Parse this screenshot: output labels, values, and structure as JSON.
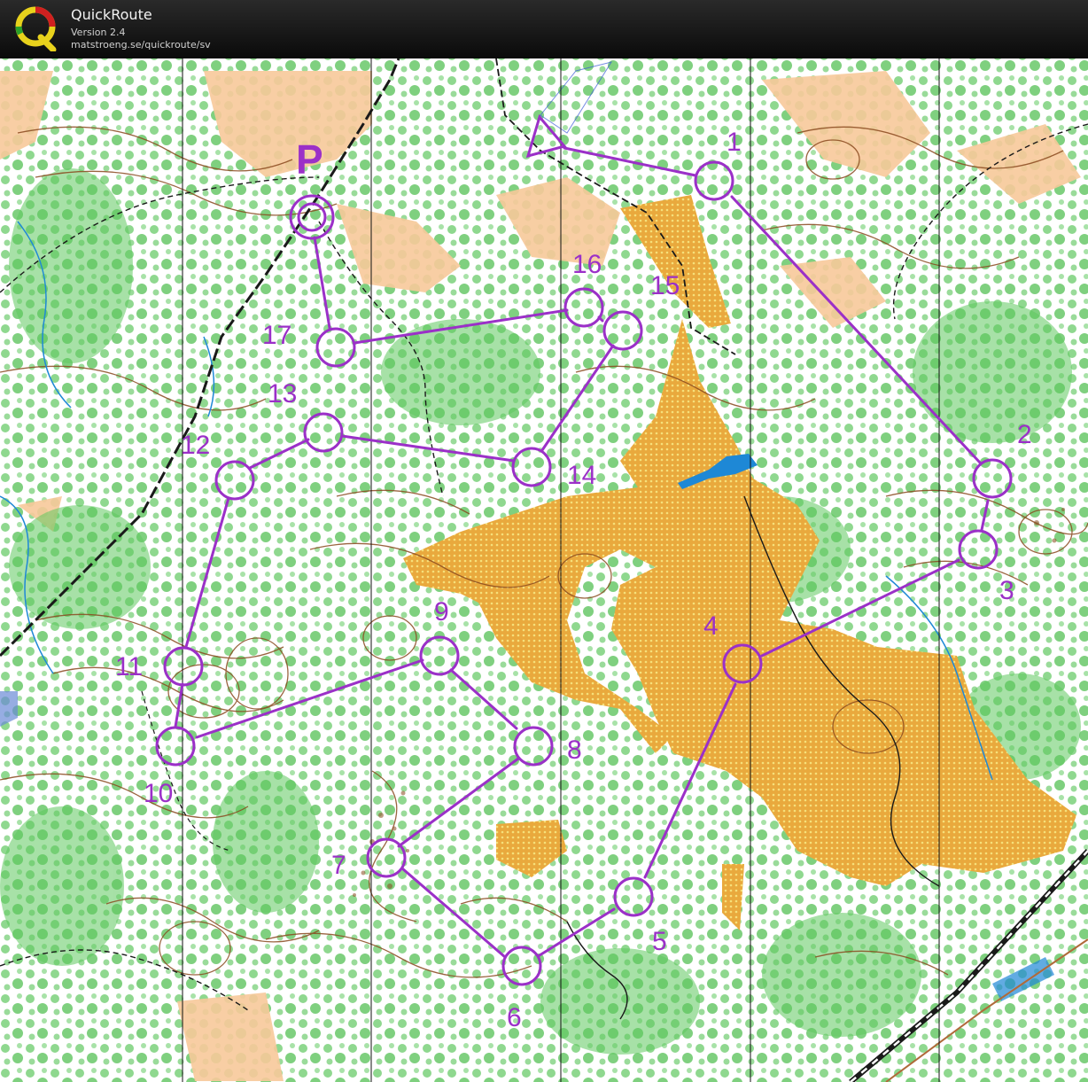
{
  "app": {
    "name": "QuickRoute",
    "version": "Version 2.4",
    "url": "matstroeng.se/quickroute/sv",
    "logo_letter": "Q"
  },
  "colors": {
    "course": "#9b30c8",
    "forest_green": "#6fcf6f",
    "open_land": "#f7c99a",
    "rough_yellow": "#e9a93d",
    "contour_brown": "#8a4a1f",
    "water_blue": "#1e88d6",
    "track_black": "#1a1a1a"
  },
  "map": {
    "start_label": "P",
    "controls": [
      {
        "label": "1"
      },
      {
        "label": "2"
      },
      {
        "label": "3"
      },
      {
        "label": "4"
      },
      {
        "label": "5"
      },
      {
        "label": "6"
      },
      {
        "label": "7"
      },
      {
        "label": "8"
      },
      {
        "label": "9"
      },
      {
        "label": "10"
      },
      {
        "label": "11"
      },
      {
        "label": "12"
      },
      {
        "label": "13"
      },
      {
        "label": "14"
      },
      {
        "label": "15"
      },
      {
        "label": "16"
      },
      {
        "label": "17"
      }
    ]
  }
}
